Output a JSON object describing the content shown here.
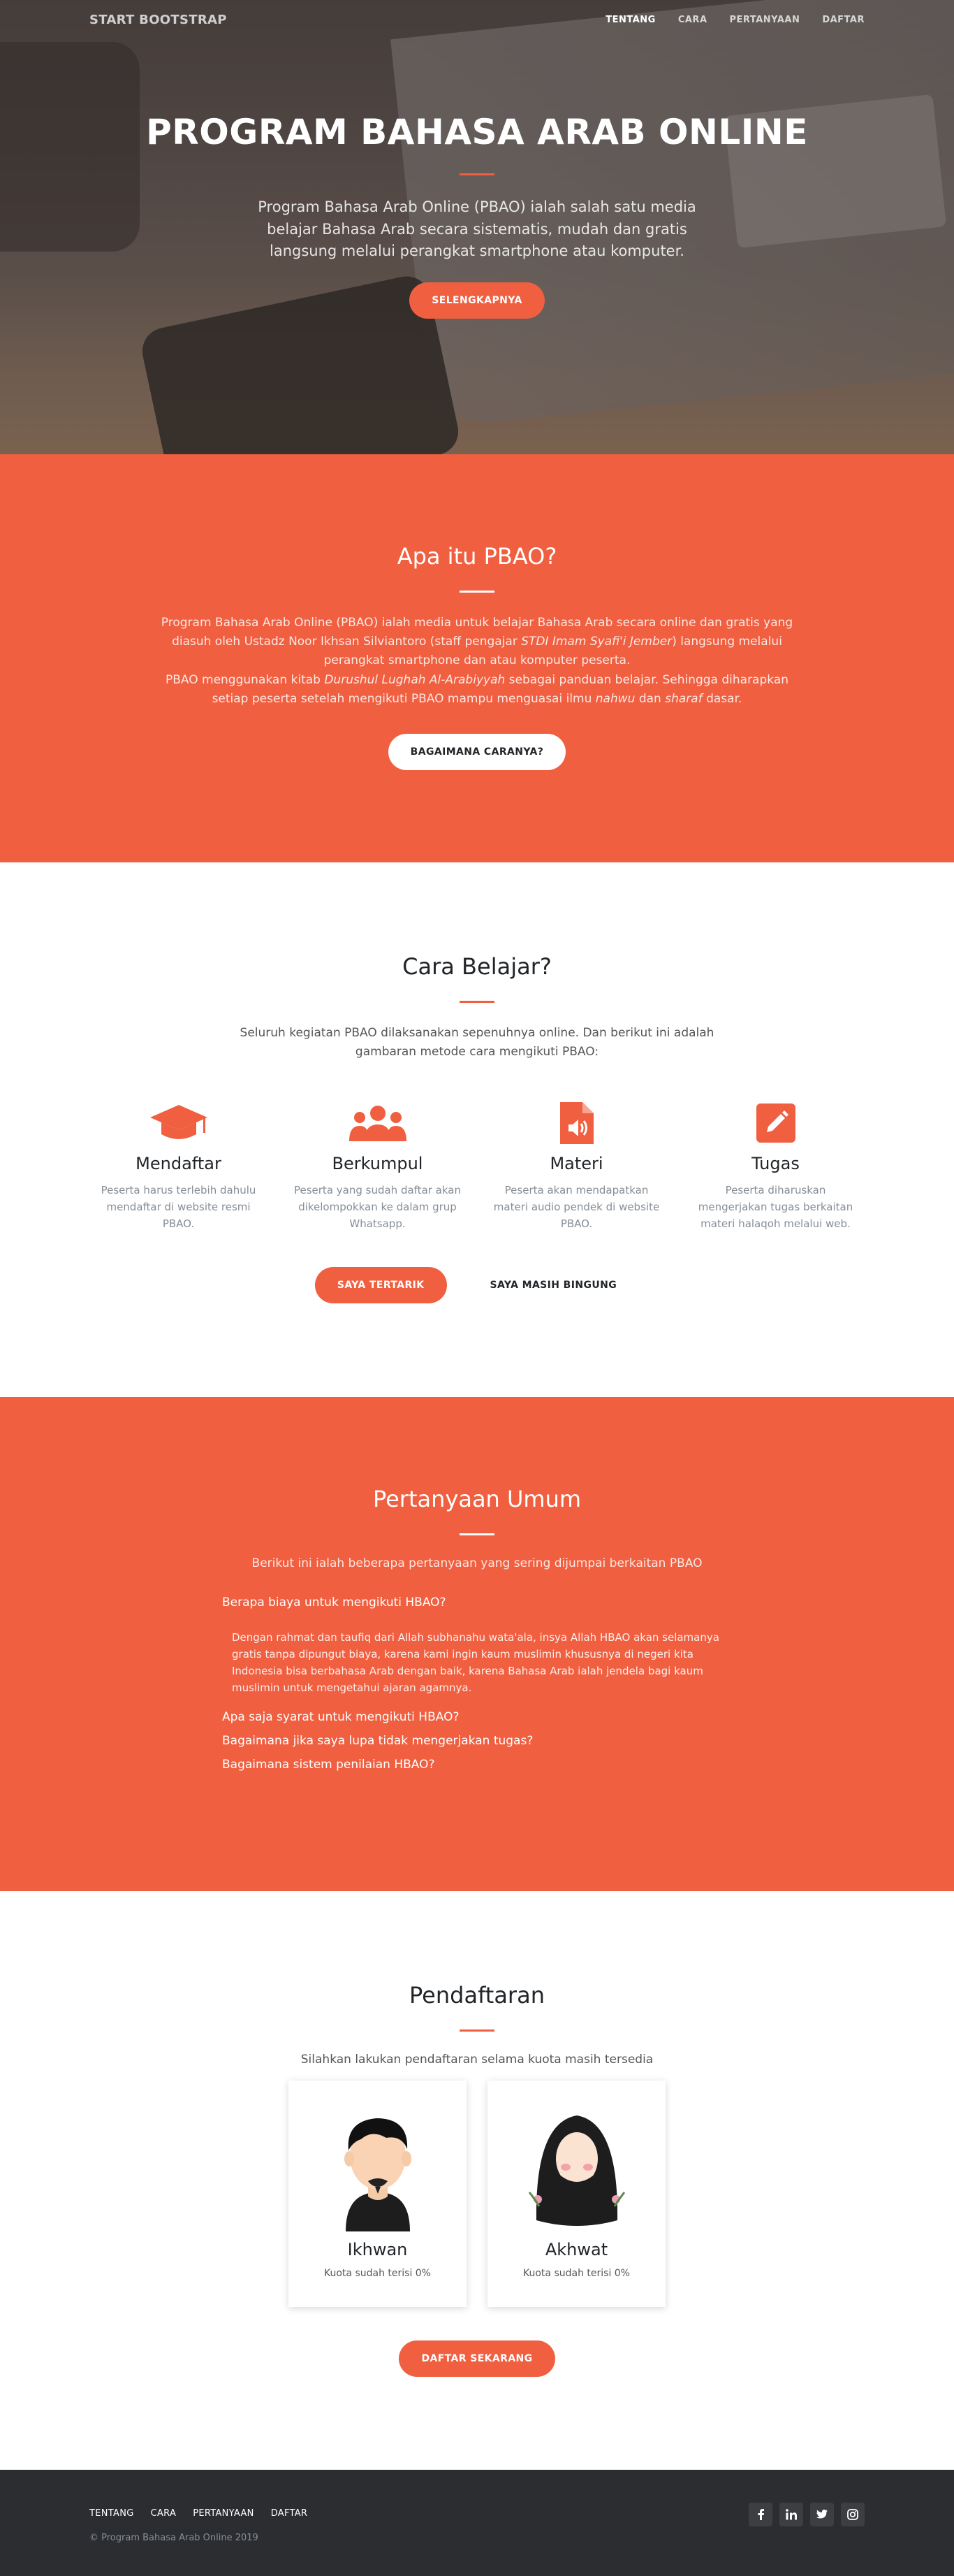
{
  "nav": {
    "brand": "START BOOTSTRAP",
    "links": [
      "TENTANG",
      "CARA",
      "PERTANYAAN",
      "DAFTAR"
    ]
  },
  "hero": {
    "title": "PROGRAM BAHASA ARAB ONLINE",
    "subtitle": "Program Bahasa Arab Online (PBAO) ialah salah satu media belajar Bahasa Arab secara sistematis, mudah dan gratis langsung melalui perangkat smartphone atau komputer.",
    "button": "SELENGKAPNYA"
  },
  "about": {
    "title": "Apa itu PBAO?",
    "p1_a": "Program Bahasa Arab Online (PBAO) ialah media untuk belajar Bahasa Arab secara online dan gratis yang diasuh oleh Ustadz Noor Ikhsan Silviantoro (staff pengajar ",
    "p1_em": "STDI Imam Syafi'i Jember",
    "p1_b": ") langsung melalui perangkat smartphone dan atau komputer peserta.",
    "p2_a": "PBAO menggunakan kitab ",
    "p2_em1": "Durushul Lughah Al-Arabiyyah",
    "p2_b": " sebagai panduan belajar. Sehingga diharapkan setiap peserta setelah mengikuti PBAO mampu menguasai ilmu ",
    "p2_em2": "nahwu",
    "p2_c": " dan ",
    "p2_em3": "sharaf",
    "p2_d": " dasar.",
    "button": "BAGAIMANA CARANYA?"
  },
  "cara": {
    "title": "Cara Belajar?",
    "intro": "Seluruh kegiatan PBAO dilaksanakan sepenuhnya online. Dan berikut ini adalah gambaran metode cara mengikuti PBAO:",
    "features": [
      {
        "icon": "graduation-cap-icon",
        "title": "Mendaftar",
        "text": "Peserta harus terlebih dahulu mendaftar di website resmi PBAO."
      },
      {
        "icon": "users-icon",
        "title": "Berkumpul",
        "text": "Peserta yang sudah daftar akan dikelompokkan ke dalam grup Whatsapp."
      },
      {
        "icon": "audio-file-icon",
        "title": "Materi",
        "text": "Peserta akan mendapatkan materi audio pendek di website PBAO."
      },
      {
        "icon": "pencil-square-icon",
        "title": "Tugas",
        "text": "Peserta diharuskan mengerjakan tugas berkaitan materi halaqoh melalui web."
      }
    ],
    "primary_button": "SAYA TERTARIK",
    "secondary_button": "SAYA MASIH BINGUNG"
  },
  "faq": {
    "title": "Pertanyaan Umum",
    "intro": "Berikut ini ialah beberapa pertanyaan yang sering dijumpai berkaitan PBAO",
    "items": [
      {
        "q": "Berapa biaya untuk mengikuti HBAO?",
        "a": "Dengan rahmat dan taufiq dari Allah subhanahu wata'ala, insya Allah HBAO akan selamanya gratis tanpa dipungut biaya, karena kami ingin kaum muslimin khususnya di negeri kita Indonesia bisa berbahasa Arab dengan baik, karena Bahasa Arab ialah jendela bagi kaum muslimin untuk mengetahui ajaran agamnya."
      },
      {
        "q": "Apa saja syarat untuk mengikuti HBAO?"
      },
      {
        "q": "Bagaimana jika saya lupa tidak mengerjakan tugas?"
      },
      {
        "q": "Bagaimana sistem penilaian HBAO?"
      }
    ]
  },
  "daftar": {
    "title": "Pendaftaran",
    "intro": "Silahkan lakukan pendaftaran selama kuota masih tersedia",
    "cards": [
      {
        "title": "Ikhwan",
        "quota": "Kuota sudah terisi 0%",
        "quota_fraction": 0
      },
      {
        "title": "Akhwat",
        "quota": "Kuota sudah terisi 0%",
        "quota_fraction": 0
      }
    ],
    "button": "DAFTAR SEKARANG"
  },
  "footer": {
    "links": [
      "TENTANG",
      "CARA",
      "PERTANYAAN",
      "DAFTAR"
    ],
    "copyright": "© Program Bahasa Arab Online 2019",
    "socials": [
      "facebook-icon",
      "linkedin-icon",
      "twitter-icon",
      "instagram-icon"
    ]
  },
  "colors": {
    "accent": "#f05f40",
    "footer": "#2b2d30"
  }
}
